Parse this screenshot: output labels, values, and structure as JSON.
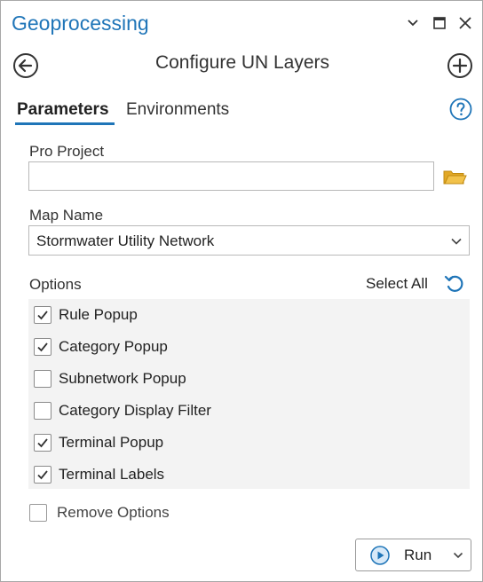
{
  "window": {
    "title": "Geoprocessing",
    "controls": [
      "chevron-down-icon",
      "maximize-icon",
      "close-icon"
    ]
  },
  "tool": {
    "title": "Configure UN Layers",
    "back_icon": "back-arrow-icon",
    "add_icon": "plus-circle-icon"
  },
  "tabs": [
    {
      "label": "Parameters",
      "active": true
    },
    {
      "label": "Environments",
      "active": false
    }
  ],
  "help_icon": "help-icon",
  "params": {
    "pro_project": {
      "label": "Pro Project",
      "value": "",
      "browse_icon": "folder-icon"
    },
    "map_name": {
      "label": "Map Name",
      "value": "Stormwater Utility Network"
    },
    "options": {
      "label": "Options",
      "select_all_label": "Select All",
      "reset_icon": "reset-icon",
      "items": [
        {
          "label": "Rule Popup",
          "checked": true
        },
        {
          "label": "Category Popup",
          "checked": true
        },
        {
          "label": "Subnetwork Popup",
          "checked": false
        },
        {
          "label": "Category Display Filter",
          "checked": false
        },
        {
          "label": "Terminal Popup",
          "checked": true
        },
        {
          "label": "Terminal Labels",
          "checked": true
        }
      ]
    },
    "remove_options": {
      "label": "Remove Options",
      "checked": false
    }
  },
  "run": {
    "label": "Run",
    "icon": "play-icon"
  },
  "colors": {
    "accent": "#1f75b8",
    "folder": "#e2a826"
  }
}
